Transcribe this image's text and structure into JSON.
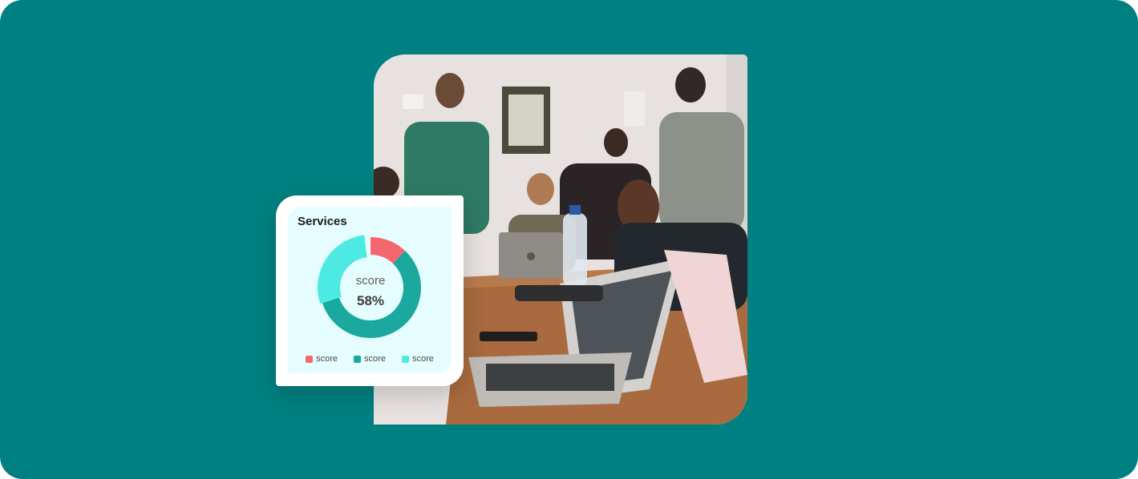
{
  "card": {
    "title": "Services",
    "center_label": "score",
    "center_value": "58%"
  },
  "chart_data": {
    "type": "pie",
    "variant": "donut",
    "title": "Services",
    "center_text": "score 58%",
    "slices": [
      {
        "label": "score",
        "value": 14,
        "color": "#f4676e"
      },
      {
        "label": "score",
        "value": 58,
        "color": "#1aa89f"
      },
      {
        "label": "score",
        "value": 28,
        "color": "#4ceae3"
      }
    ],
    "legend_position": "bottom"
  },
  "colors": {
    "background": "#008080",
    "card": "#ffffff",
    "card_inner": "#e6fdff"
  }
}
